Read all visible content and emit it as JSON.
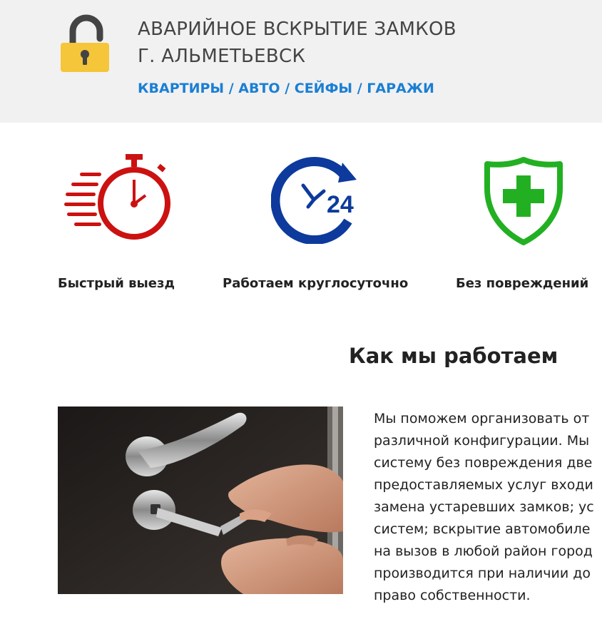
{
  "header": {
    "title_line1": "АВАРИЙНОЕ ВСКРЫТИЕ ЗАМКОВ",
    "title_line2": "Г. АЛЬМЕТЬЕВСК",
    "services": "КВАРТИРЫ / АВТО / СЕЙФЫ / ГАРАЖИ",
    "logo_icon": "padlock-open-icon",
    "colors": {
      "logo_yellow": "#f5c53a",
      "logo_shackle": "#444444",
      "services": "#1a7fd4",
      "header_bg": "#f1f1f1"
    }
  },
  "features": [
    {
      "icon": "stopwatch-icon",
      "label": "Быстрый выезд",
      "color": "#cc1111"
    },
    {
      "icon": "clock-24-icon",
      "label": "Работаем круглосуточно",
      "color": "#0d3a9c"
    },
    {
      "icon": "shield-plus-icon",
      "label": "Без повреждений",
      "color": "#22b022"
    }
  ],
  "how_we_work": {
    "title": "Как мы работаем",
    "image_icon": "door-lock-photo",
    "text_lines": [
      "Мы поможем организовать от",
      "различной конфигурации. Мы",
      "систему без повреждения две",
      "предоставляемых услуг входи",
      "замена устаревших замков; ус",
      "систем; вскрытие автомобиле",
      "на вызов в любой район город",
      "производится при наличии до",
      "право собственности."
    ]
  }
}
